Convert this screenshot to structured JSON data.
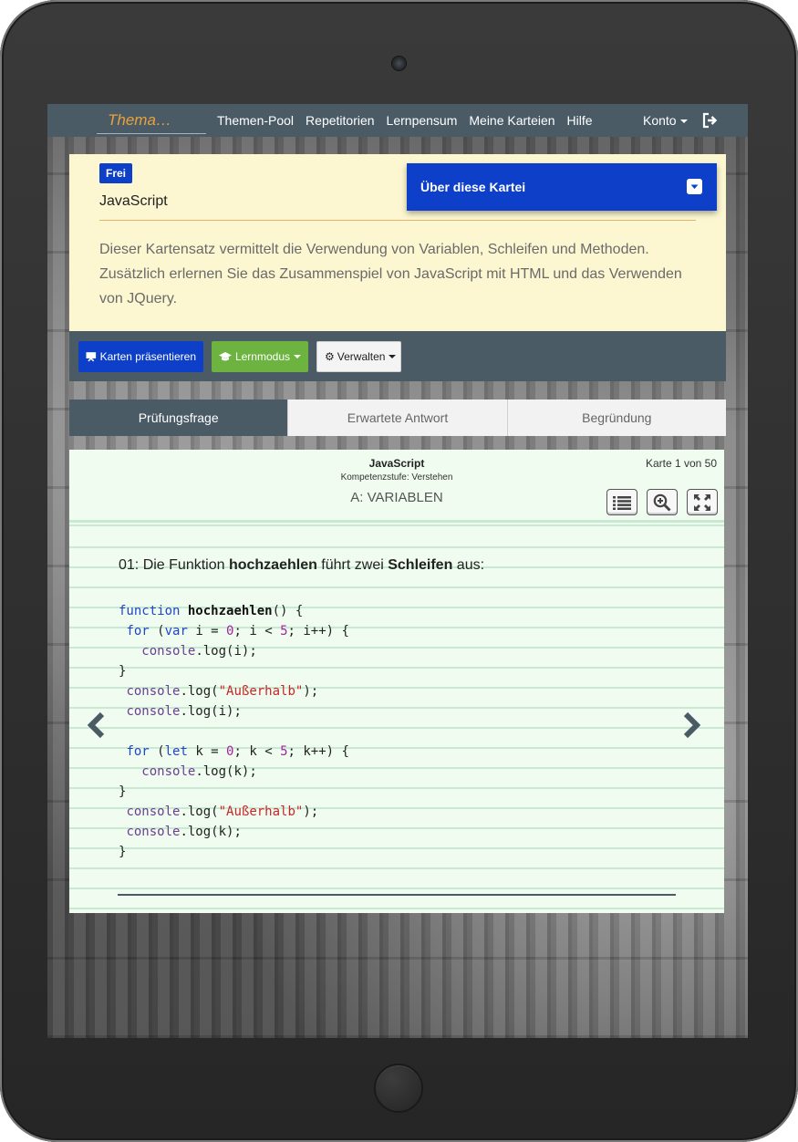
{
  "navbar": {
    "brand": "Thema…",
    "links": [
      "Themen-Pool",
      "Repetitorien",
      "Lernpensum",
      "Meine Karteien",
      "Hilfe"
    ],
    "account": "Konto"
  },
  "info": {
    "badge": "Frei",
    "title": "JavaScript",
    "description": "Dieser Kartensatz vermittelt die Verwendung von Variablen, Schleifen und Methoden. Zusätzlich erlernen Sie das Zusammenspiel von JavaScript mit HTML und das Verwenden von JQuery.",
    "about_label": "Über diese Kartei"
  },
  "toolbar": {
    "present_label": "Karten präsentieren",
    "learn_label": "Lernmodus",
    "manage_label": "Verwalten"
  },
  "tabs": [
    "Prüfungsfrage",
    "Erwartete Antwort",
    "Begründung"
  ],
  "card": {
    "deck": "JavaScript",
    "level": "Kompetenzstufe: Verstehen",
    "category": "A: VARIABLEN",
    "counter": "Karte 1 von 50",
    "question": {
      "prefix": "01: Die Funktion ",
      "func_name": "hochzaehlen",
      "middle": " führt zwei ",
      "loops_word": "Schleifen",
      "suffix": " aus:"
    },
    "code_lines": [
      "function hochzaehlen() {",
      " for (var i = 0; i < 5; i++) {",
      "   console.log(i);",
      "}",
      " console.log(\"Außerhalb\");",
      " console.log(i);",
      "",
      " for (let k = 0; k < 5; k++) {",
      "   console.log(k);",
      "}",
      " console.log(\"Außerhalb\");",
      " console.log(k);",
      "}"
    ]
  },
  "colors": {
    "navbar": "#4a5b66",
    "brand": "#e9a23b",
    "primary": "#0d3fc8",
    "success": "#6cb33f",
    "info_bg": "#fcf7d1",
    "card_bg": "#effcef"
  },
  "icons": [
    "logout-icon",
    "toggle-icon",
    "presentation-icon",
    "graduation-cap-icon",
    "gear-icon",
    "list-icon",
    "zoom-in-icon",
    "fullscreen-icon",
    "chevron-left-icon",
    "chevron-right-icon"
  ]
}
